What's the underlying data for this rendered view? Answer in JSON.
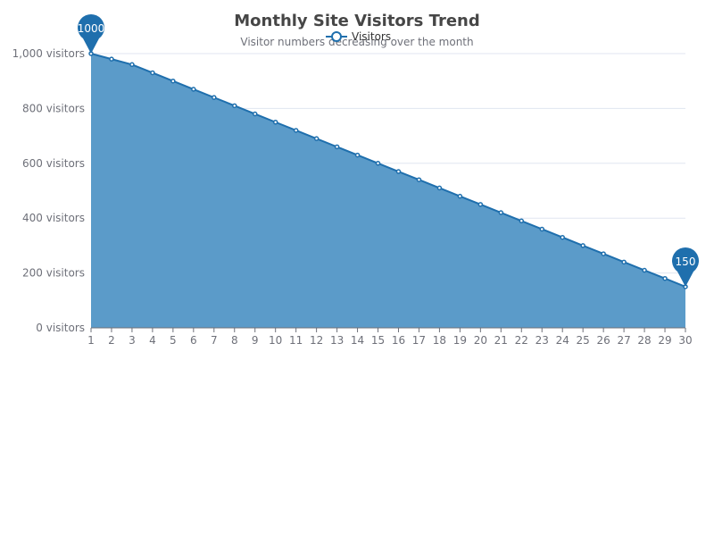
{
  "chart_data": {
    "type": "area",
    "title": "Monthly Site Visitors Trend",
    "subtitle": "Visitor numbers decreasing over the month",
    "legend": {
      "items": [
        "Visitors"
      ],
      "position": "top-center"
    },
    "x": [
      1,
      2,
      3,
      4,
      5,
      6,
      7,
      8,
      9,
      10,
      11,
      12,
      13,
      14,
      15,
      16,
      17,
      18,
      19,
      20,
      21,
      22,
      23,
      24,
      25,
      26,
      27,
      28,
      29,
      30
    ],
    "series": [
      {
        "name": "Visitors",
        "values": [
          1000,
          980,
          960,
          930,
          900,
          870,
          840,
          810,
          780,
          750,
          720,
          690,
          660,
          630,
          600,
          570,
          540,
          510,
          480,
          450,
          420,
          390,
          360,
          330,
          300,
          270,
          240,
          210,
          180,
          150
        ]
      }
    ],
    "y_ticks": [
      "0 visitors",
      "200 visitors",
      "400 visitors",
      "600 visitors",
      "800 visitors",
      "1,000 visitors"
    ],
    "ylim": [
      0,
      1000
    ],
    "grid": true,
    "markers": [
      {
        "label": "1000",
        "x": 1,
        "y": 1000
      },
      {
        "label": "150",
        "x": 30,
        "y": 150
      }
    ],
    "colors": {
      "series": "#1f6fad",
      "area": "#5b9bc9",
      "grid": "#e0e6f1",
      "axis": "#6e7079"
    }
  }
}
